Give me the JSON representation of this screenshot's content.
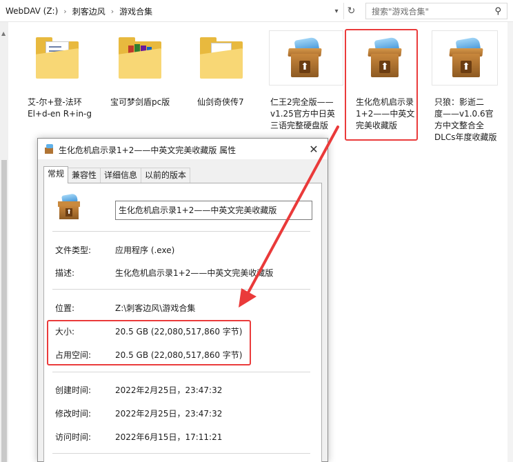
{
  "explorer": {
    "breadcrumbs": [
      "WebDAV (Z:)",
      "刺客边风",
      "游戏合集"
    ],
    "search_placeholder": "搜索\"游戏合集\"",
    "files": [
      {
        "name": "艾-尔+登-法环\nEl+d-en R+in-g",
        "kind": "folder-doc"
      },
      {
        "name": "宝可梦剑盾pc版",
        "kind": "folder-books"
      },
      {
        "name": "仙剑奇侠传7",
        "kind": "folder-plain"
      },
      {
        "name": "仁王2完全版——\nv1.25官方中日英\n三语完整硬盘版",
        "kind": "installer"
      },
      {
        "name": "生化危机启示录\n1+2——中英文\n完美收藏版",
        "kind": "installer"
      },
      {
        "name": "只狼：影逝二\n度——v1.0.6官\n方中文整合全\nDLCs年度收藏版",
        "kind": "installer"
      }
    ],
    "icons": {
      "dropdown": "chevron-down-icon",
      "refresh": "refresh-icon",
      "search": "search-icon"
    }
  },
  "dialog": {
    "title": "生化危机启示录1+2——中英文完美收藏版 属性",
    "tabs": [
      "常规",
      "兼容性",
      "详细信息",
      "以前的版本"
    ],
    "file_name": "生化危机启示录1+2——中英文完美收藏版",
    "rows": {
      "type": {
        "label": "文件类型:",
        "value": "应用程序 (.exe)"
      },
      "desc": {
        "label": "描述:",
        "value": "生化危机启示录1+2——中英文完美收藏版"
      },
      "location": {
        "label": "位置:",
        "value": "Z:\\刺客边风\\游戏合集"
      },
      "size": {
        "label": "大小:",
        "value": "20.5 GB (22,080,517,860 字节)"
      },
      "disk_size": {
        "label": "占用空间:",
        "value": "20.5 GB (22,080,517,860 字节)"
      },
      "created": {
        "label": "创建时间:",
        "value": "2022年2月25日，23:47:32"
      },
      "modified": {
        "label": "修改时间:",
        "value": "2022年2月25日，23:47:32"
      },
      "accessed": {
        "label": "访问时间:",
        "value": "2022年6月15日，17:11:21"
      }
    }
  },
  "annotation_color": "#ea3a3a"
}
